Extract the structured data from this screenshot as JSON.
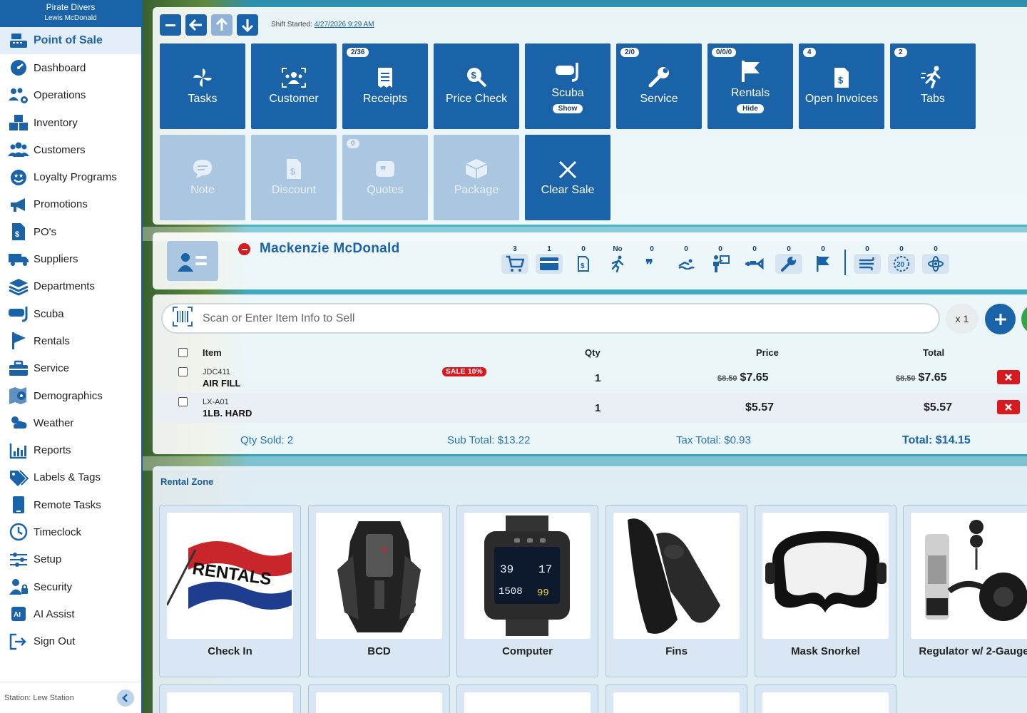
{
  "sidebar": {
    "company": "Pirate Divers",
    "user": "Lewis McDonald",
    "items": [
      {
        "label": "Point of Sale",
        "icon": "cash-register-icon"
      },
      {
        "label": "Dashboard",
        "icon": "gauge-icon"
      },
      {
        "label": "Operations",
        "icon": "people-gear-icon"
      },
      {
        "label": "Inventory",
        "icon": "boxes-icon"
      },
      {
        "label": "Customers",
        "icon": "users-icon"
      },
      {
        "label": "Loyalty Programs",
        "icon": "star-face-icon"
      },
      {
        "label": "Promotions",
        "icon": "megaphone-icon"
      },
      {
        "label": "PO's",
        "icon": "invoice-dollar-icon"
      },
      {
        "label": "Suppliers",
        "icon": "truck-icon"
      },
      {
        "label": "Departments",
        "icon": "layers-icon"
      },
      {
        "label": "Scuba",
        "icon": "dive-mask-icon"
      },
      {
        "label": "Rentals",
        "icon": "flag-icon"
      },
      {
        "label": "Service",
        "icon": "toolbox-icon"
      },
      {
        "label": "Demographics",
        "icon": "map-pin-icon"
      },
      {
        "label": "Weather",
        "icon": "cloud-sun-icon"
      },
      {
        "label": "Reports",
        "icon": "bar-chart-icon"
      },
      {
        "label": "Labels & Tags",
        "icon": "tags-icon"
      },
      {
        "label": "Remote Tasks",
        "icon": "tablet-icon"
      },
      {
        "label": "Timeclock",
        "icon": "clock-icon"
      },
      {
        "label": "Setup",
        "icon": "sliders-icon"
      },
      {
        "label": "Security",
        "icon": "user-lock-icon"
      },
      {
        "label": "AI Assist",
        "icon": "ai-icon"
      },
      {
        "label": "Sign Out",
        "icon": "sign-out-icon"
      }
    ],
    "station": "Station: Lew Station"
  },
  "shift": {
    "label": "Shift Started:",
    "value": "4/27/2026 9:29 AM"
  },
  "tiles": [
    {
      "label": "Tasks",
      "badge": "",
      "pill": ""
    },
    {
      "label": "Customer",
      "badge": "",
      "pill": ""
    },
    {
      "label": "Receipts",
      "badge": "2/36",
      "pill": ""
    },
    {
      "label": "Price Check",
      "badge": "",
      "pill": ""
    },
    {
      "label": "Scuba",
      "badge": "",
      "pill": "Show"
    },
    {
      "label": "Service",
      "badge": "2/0",
      "pill": ""
    },
    {
      "label": "Rentals",
      "badge": "0/0/0",
      "pill": "Hide"
    },
    {
      "label": "Open Invoices",
      "badge": "4",
      "pill": ""
    },
    {
      "label": "Tabs",
      "badge": "2",
      "pill": ""
    },
    {
      "label": "Note",
      "badge": "",
      "pill": ""
    },
    {
      "label": "Discount",
      "badge": "",
      "pill": ""
    },
    {
      "label": "Quotes",
      "badge": "0",
      "pill": ""
    },
    {
      "label": "Package",
      "badge": "",
      "pill": ""
    },
    {
      "label": "Clear Sale",
      "badge": "",
      "pill": ""
    }
  ],
  "customer": {
    "name": "Mackenzie McDonald",
    "stats": [
      {
        "count": "3",
        "icon": "cart-icon"
      },
      {
        "count": "1",
        "icon": "credit-card-icon"
      },
      {
        "count": "0",
        "icon": "invoice-dollar-icon"
      },
      {
        "count": "No",
        "icon": "running-person-icon"
      },
      {
        "count": "0",
        "icon": "quote-icon"
      },
      {
        "count": "0",
        "icon": "swimmer-icon"
      },
      {
        "count": "0",
        "icon": "instructor-icon"
      },
      {
        "count": "0",
        "icon": "diver-icon"
      },
      {
        "count": "0",
        "icon": "wrench-icon"
      },
      {
        "count": "0",
        "icon": "flag-icon"
      },
      {
        "count": "0",
        "icon": "wind-icon"
      },
      {
        "count": "0",
        "icon": "twenty-icon"
      },
      {
        "count": "0",
        "icon": "atom-icon"
      }
    ]
  },
  "sale": {
    "scan_placeholder": "Scan or Enter Item Info to Sell",
    "qty_multiplier": "x 1",
    "headers": {
      "item": "Item",
      "qty": "Qty",
      "price": "Price",
      "total": "Total"
    },
    "rows": [
      {
        "sku": "JDC411",
        "desc": "AIR FILL",
        "tag": "SALE 10%",
        "qty": "1",
        "orig_price": "$8.50",
        "price": "$7.65",
        "orig_total": "$8.50",
        "total": "$7.65"
      },
      {
        "sku": "LX-A01",
        "desc": "1LB. HARD",
        "tag": "",
        "qty": "1",
        "orig_price": "",
        "price": "$5.57",
        "orig_total": "",
        "total": "$5.57"
      }
    ],
    "totals": {
      "qty_sold": "Qty Sold:  2",
      "sub_total": "Sub Total:  $13.22",
      "tax_total": "Tax Total:  $0.93",
      "total": "Total:  $14.15"
    }
  },
  "rental_zone": {
    "title": "Rental Zone",
    "items": [
      {
        "label": "Check In"
      },
      {
        "label": "BCD"
      },
      {
        "label": "Computer"
      },
      {
        "label": "Fins"
      },
      {
        "label": "Mask Snorkel"
      },
      {
        "label": "Regulator w/ 2-Gauge"
      }
    ],
    "flag_text": "RENTALS",
    "computer_readout": {
      "left_top": "39",
      "right_top": "17",
      "left_bottom": "1508",
      "right_bottom": "99"
    }
  }
}
